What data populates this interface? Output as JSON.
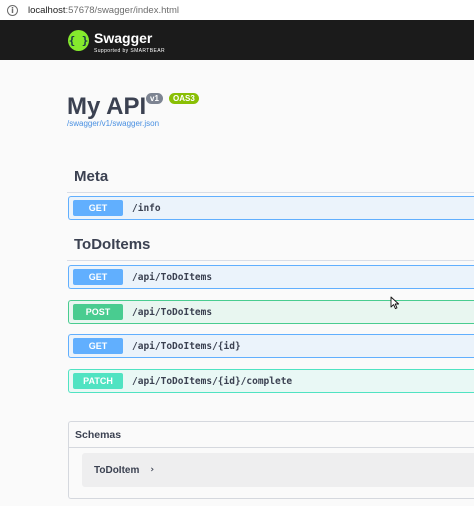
{
  "browser": {
    "url_host": "localhost",
    "url_rest": ":57678/swagger/index.html",
    "info_icon": "info-icon"
  },
  "topbar": {
    "logo_icon": "swagger-logo-icon",
    "logo_glyph": "{ }",
    "brand": "Swagger",
    "tagline": "Supported by SMARTBEAR"
  },
  "info": {
    "title": "My API",
    "version": "v1",
    "oas": "OAS3",
    "spec_url": "/swagger/v1/swagger.json"
  },
  "tags": [
    {
      "name": "Meta",
      "operations": [
        {
          "method": "GET",
          "path": "/info"
        }
      ]
    },
    {
      "name": "ToDoItems",
      "operations": [
        {
          "method": "GET",
          "path": "/api/ToDoItems"
        },
        {
          "method": "POST",
          "path": "/api/ToDoItems"
        },
        {
          "method": "GET",
          "path": "/api/ToDoItems/{id}"
        },
        {
          "method": "PATCH",
          "path": "/api/ToDoItems/{id}/complete"
        }
      ]
    }
  ],
  "schemas": {
    "title": "Schemas",
    "models": [
      {
        "name": "ToDoItem",
        "expand_icon": "chevron-right-icon",
        "glyph": "›"
      }
    ]
  },
  "colors": {
    "topbar": "#1b1b1b",
    "get": "#61affe",
    "post": "#49cc90",
    "patch": "#50e3c2",
    "version_badge": "#7d8492",
    "oas_badge": "#89bf04",
    "link": "#4990e2"
  }
}
